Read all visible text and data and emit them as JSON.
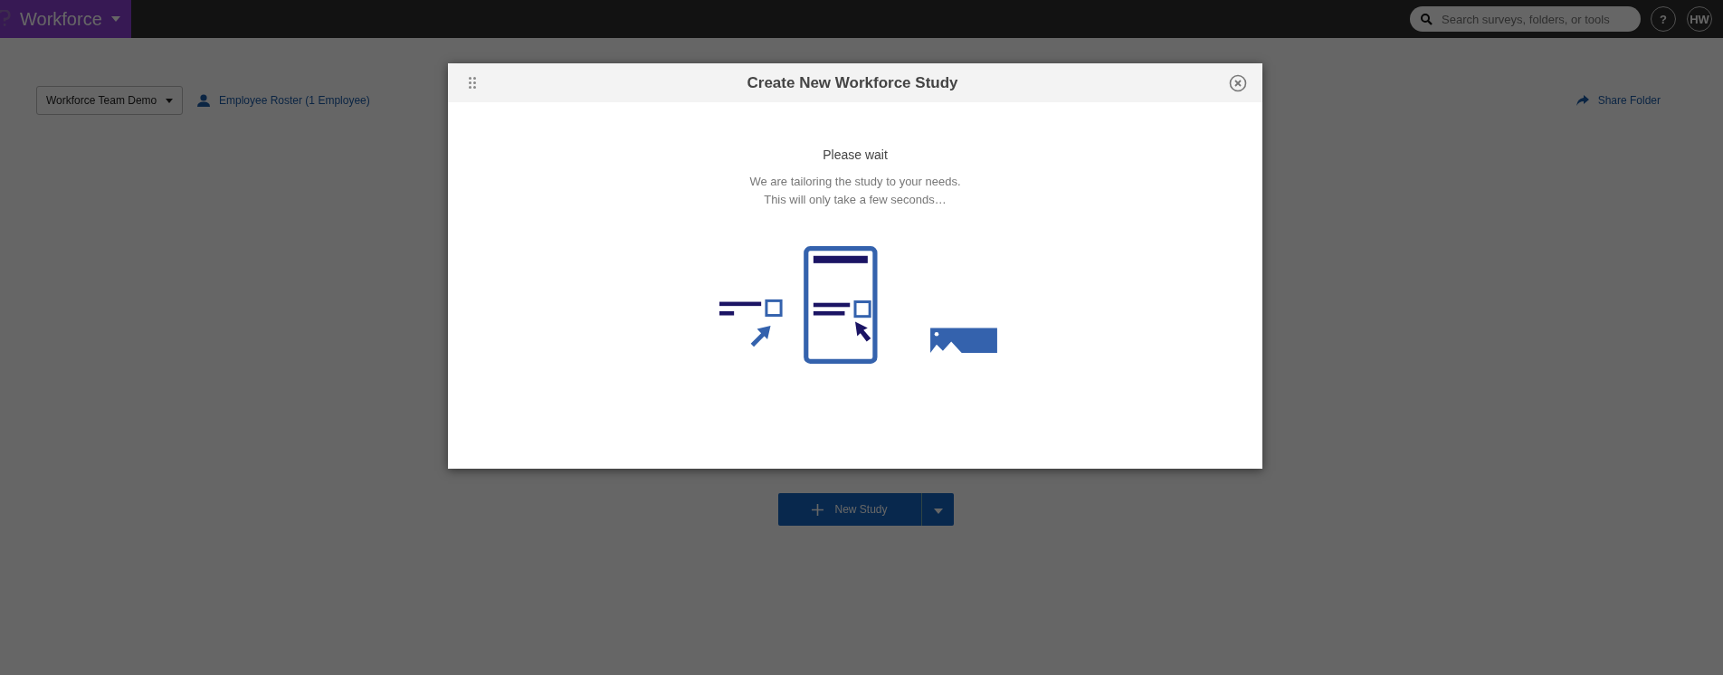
{
  "top_bar": {
    "app_name": "Workforce",
    "search": {
      "placeholder": "Search surveys, folders, or tools"
    },
    "help": "?",
    "avatar": "HW"
  },
  "toolbar": {
    "folder_dropdown": "Workforce Team Demo",
    "roster_link": "Employee Roster (1 Employee)",
    "share_link": "Share Folder"
  },
  "new_study_button": "New Study",
  "dialog": {
    "title": "Create New Workforce Study",
    "heading": "Please wait",
    "message_lines": [
      "We are tailoring the study to your needs.",
      "This will only take a few seconds…"
    ]
  }
}
